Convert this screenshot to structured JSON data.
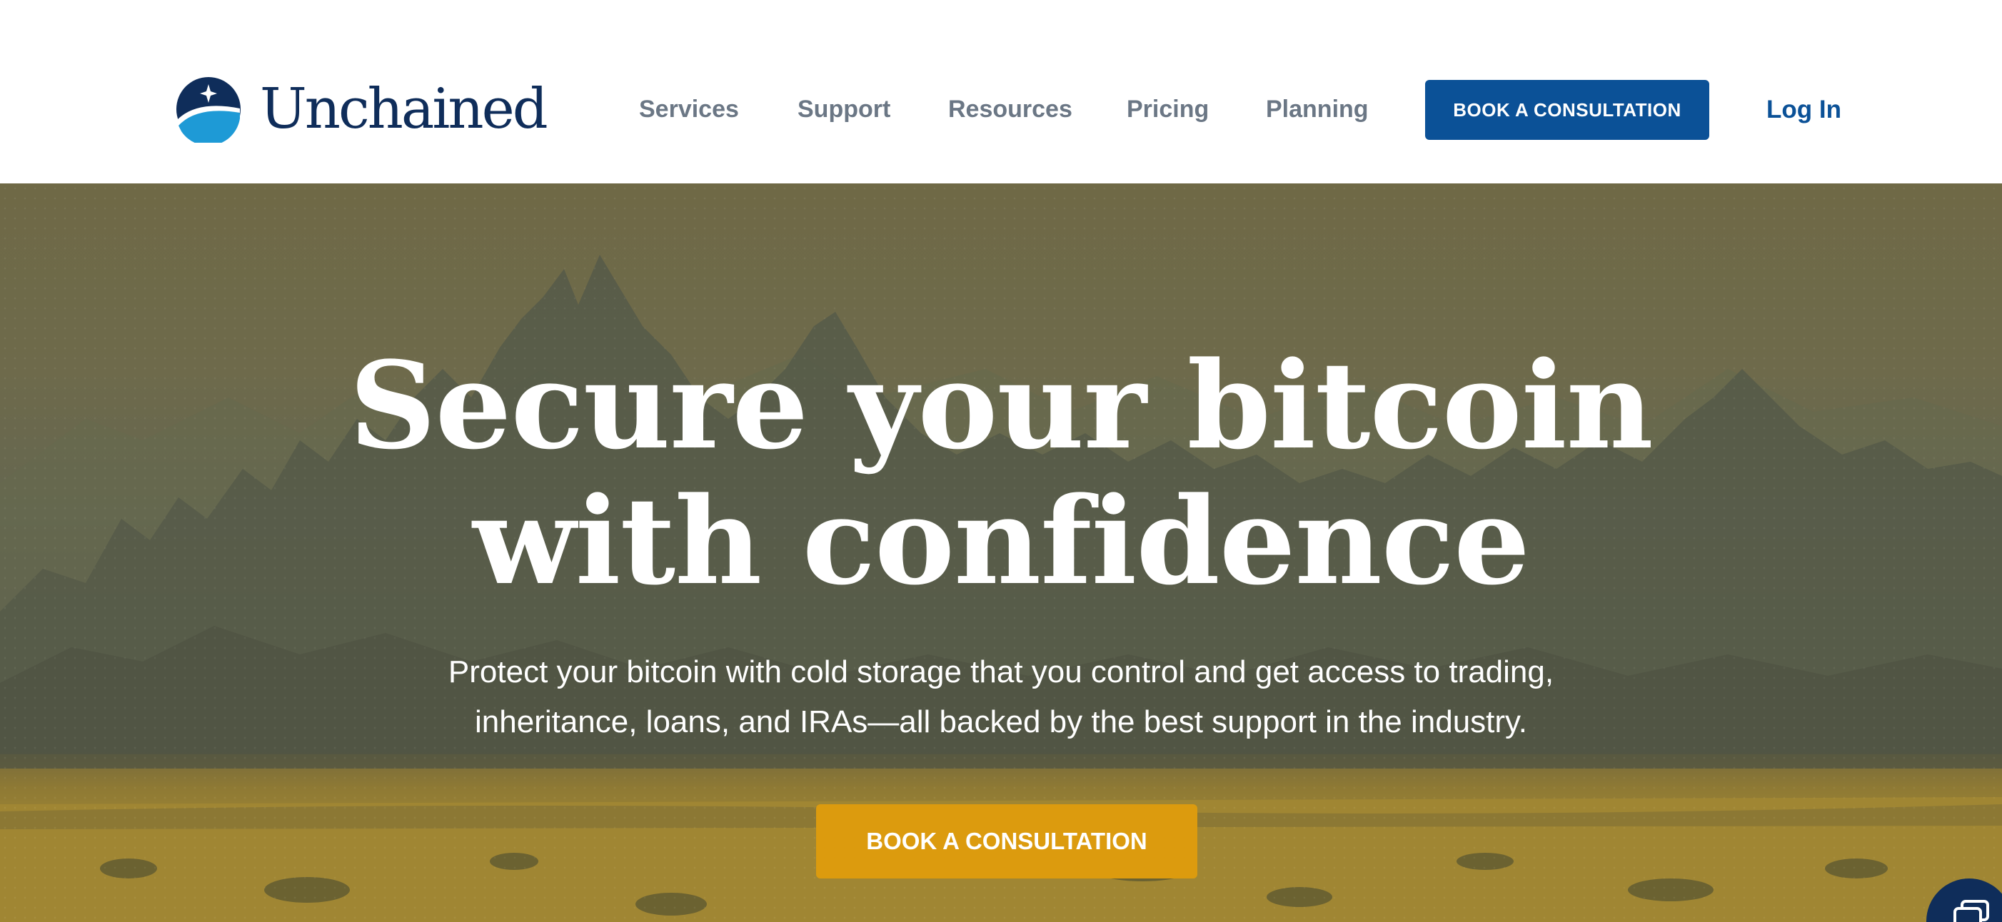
{
  "brand": {
    "name": "Unchained",
    "color": "#0f2d5a",
    "accent": "#1e9ad6"
  },
  "nav": {
    "items": [
      {
        "label": "Services"
      },
      {
        "label": "Support"
      },
      {
        "label": "Resources"
      },
      {
        "label": "Pricing"
      },
      {
        "label": "Planning"
      }
    ],
    "cta_label": "BOOK A CONSULTATION",
    "cta_color": "#0b5197",
    "login_label": "Log In"
  },
  "hero": {
    "title_line1": "Secure your bitcoin",
    "title_line2": "with confidence",
    "subtitle_line1": "Protect your bitcoin with cold storage that you control and get access to trading,",
    "subtitle_line2": "inheritance, loans, and IRAs—all backed by the best support in the industry.",
    "cta_label": "BOOK A CONSULTATION",
    "cta_color": "#dc9b0e"
  },
  "chat": {
    "icon": "chat-bubble-icon"
  }
}
